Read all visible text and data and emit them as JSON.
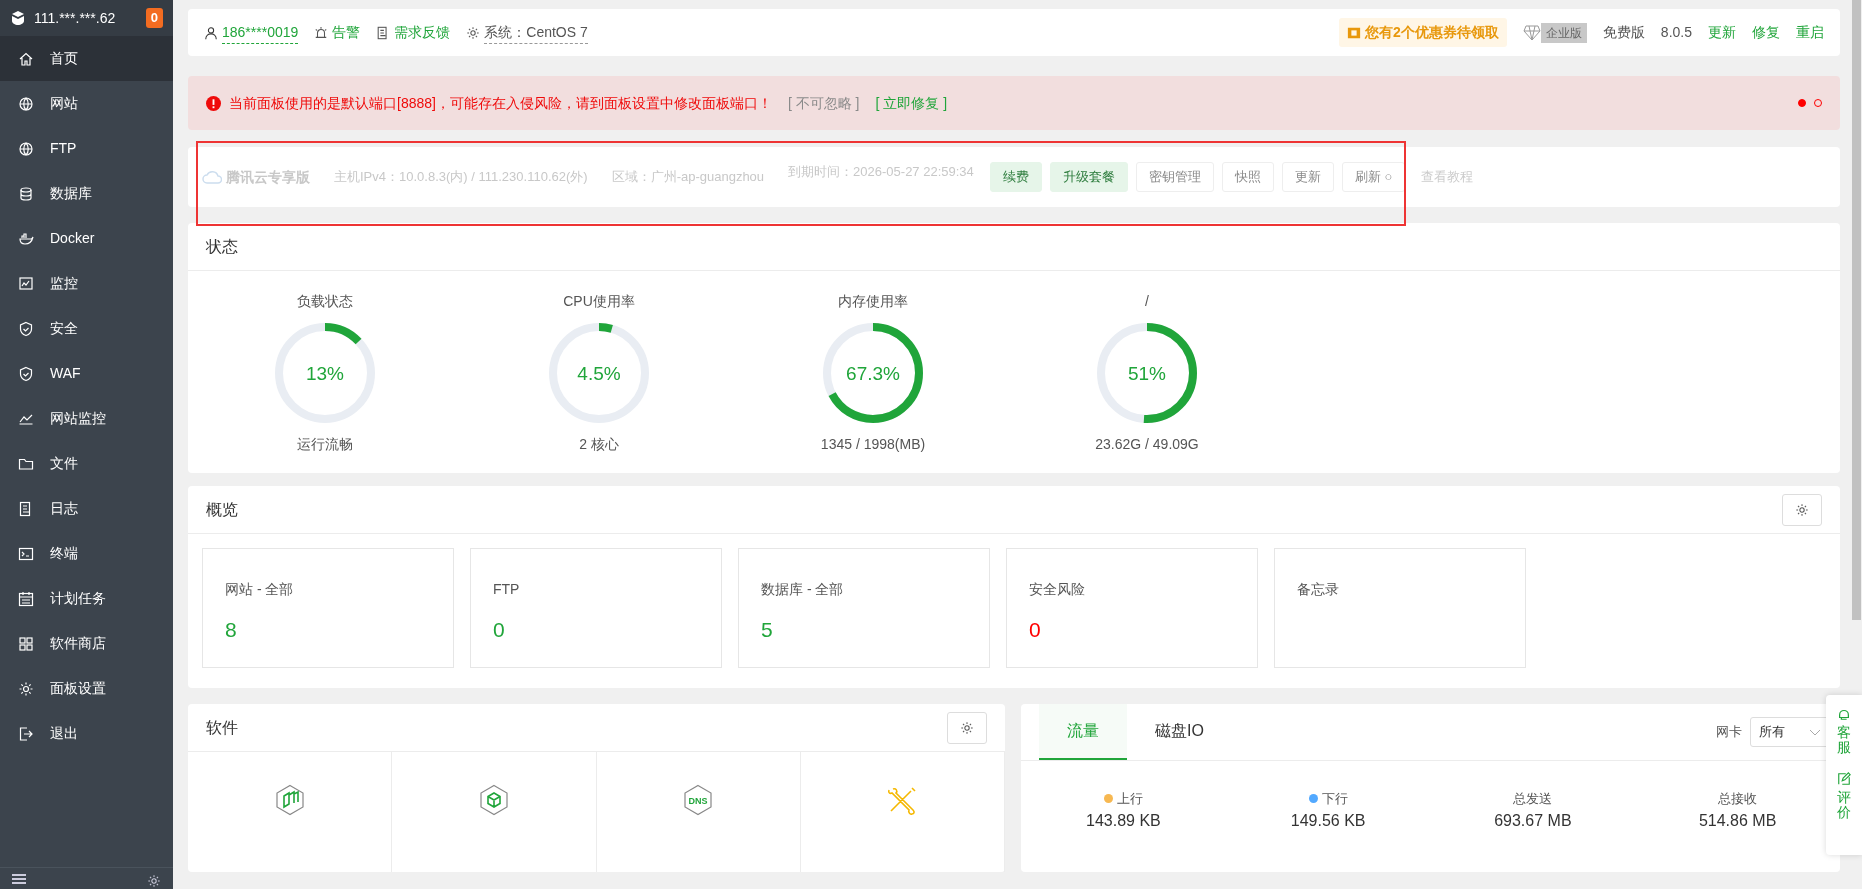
{
  "sidebar": {
    "host": "111.***.***.62",
    "badge": "0",
    "items": [
      {
        "label": "首页",
        "selected": true
      },
      {
        "label": "网站",
        "selected": false
      },
      {
        "label": "FTP",
        "selected": false
      },
      {
        "label": "数据库",
        "selected": false
      },
      {
        "label": "Docker",
        "selected": false
      },
      {
        "label": "监控",
        "selected": false
      },
      {
        "label": "安全",
        "selected": false
      },
      {
        "label": "WAF",
        "selected": false
      },
      {
        "label": "网站监控",
        "selected": false
      },
      {
        "label": "文件",
        "selected": false
      },
      {
        "label": "日志",
        "selected": false
      },
      {
        "label": "终端",
        "selected": false
      },
      {
        "label": "计划任务",
        "selected": false
      },
      {
        "label": "软件商店",
        "selected": false
      },
      {
        "label": "面板设置",
        "selected": false
      },
      {
        "label": "退出",
        "selected": false
      }
    ]
  },
  "topbar": {
    "user": "186****0019",
    "alarm": "告警",
    "feedback": "需求反馈",
    "system": "系统：CentOS 7",
    "coupon": "您有2个优惠券待领取",
    "edition_badge": "企业版",
    "edition": "免费版",
    "version": "8.0.5",
    "actions": [
      "更新",
      "修复",
      "重启"
    ]
  },
  "alert": {
    "message": "当前面板使用的是默认端口[8888]，可能存在入侵风险，请到面板设置中修改面板端口！",
    "ignore": "[ 不可忽略 ]",
    "fix": "[ 立即修复 ]",
    "dots": [
      {
        "selected": true
      },
      {
        "selected": false
      }
    ]
  },
  "instance": {
    "brand": "腾讯云专享版",
    "ipv4": "主机IPv4：10.0.8.3(内) / 111.230.110.62(外)",
    "region": "区域：广州-ap-guangzhou",
    "expiry": "到期时间：2026-05-27 22:59:34",
    "buttons": [
      {
        "label": "续费",
        "kind": "primary"
      },
      {
        "label": "升级套餐",
        "kind": "primary"
      },
      {
        "label": "密钥管理",
        "kind": "plain"
      },
      {
        "label": "快照",
        "kind": "plain"
      },
      {
        "label": "更新",
        "kind": "plain"
      },
      {
        "label": "刷新 ○",
        "kind": "plain"
      }
    ],
    "tutorial": "查看教程"
  },
  "status": {
    "title": "状态",
    "gauges": [
      {
        "title": "负载状态",
        "value": "13%",
        "level": 0.13,
        "caption": "运行流畅"
      },
      {
        "title": "CPU使用率",
        "value": "4.5%",
        "level": 0.045,
        "caption": "2 核心"
      },
      {
        "title": "内存使用率",
        "value": "67.3%",
        "level": 0.673,
        "caption": "1345 / 1998(MB)"
      },
      {
        "title": "/",
        "value": "51%",
        "level": 0.51,
        "caption": "23.62G / 49.09G"
      }
    ]
  },
  "overview": {
    "title": "概览",
    "items": [
      {
        "label": "网站 - 全部",
        "value": "8",
        "color": "#20a53a"
      },
      {
        "label": "FTP",
        "value": "0",
        "color": "#20a53a"
      },
      {
        "label": "数据库 - 全部",
        "value": "5",
        "color": "#20a53a"
      },
      {
        "label": "安全风险",
        "value": "0",
        "color": "#ff0000"
      },
      {
        "label": "备忘录"
      }
    ]
  },
  "software": {
    "title": "软件",
    "items": [
      {
        "kind": "stack"
      },
      {
        "kind": "cube"
      },
      {
        "kind": "dns",
        "text": "DNS"
      },
      {
        "kind": "tools"
      }
    ]
  },
  "traffic": {
    "tabs": [
      {
        "label": "流量",
        "selected": true
      },
      {
        "label": "磁盘IO",
        "selected": false
      }
    ],
    "nic_label": "网卡",
    "nic_value": "所有",
    "stats": [
      {
        "label": "上行",
        "value": "143.89 KB",
        "color": "#f7b851"
      },
      {
        "label": "下行",
        "value": "149.56 KB",
        "color": "#52a9ff"
      },
      {
        "label": "总发送",
        "value": "693.67 MB"
      },
      {
        "label": "总接收",
        "value": "514.86 MB"
      }
    ]
  },
  "float": [
    "客服",
    "评价"
  ]
}
